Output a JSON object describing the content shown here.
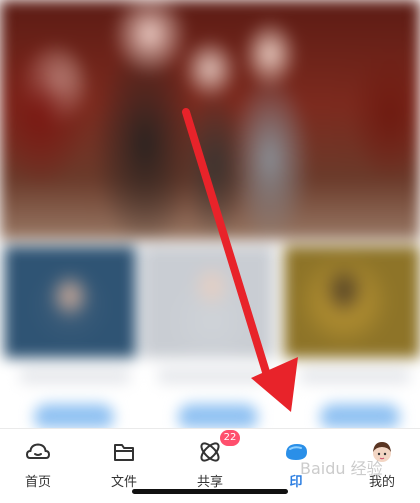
{
  "tabbar": {
    "tabs": [
      {
        "label": "首页",
        "icon": "home-icon"
      },
      {
        "label": "文件",
        "icon": "folder-icon"
      },
      {
        "label": "共享",
        "icon": "share-icon",
        "badge": "22"
      },
      {
        "label": "印",
        "icon": "print-icon",
        "active": true
      },
      {
        "label": "我的",
        "icon": "avatar-icon"
      }
    ]
  },
  "overlay": {
    "watermark": "Baidu 经验",
    "arrow_color": "#e8232a"
  },
  "colors": {
    "accent": "#2a7de1",
    "badge": "#ff4f6d"
  }
}
